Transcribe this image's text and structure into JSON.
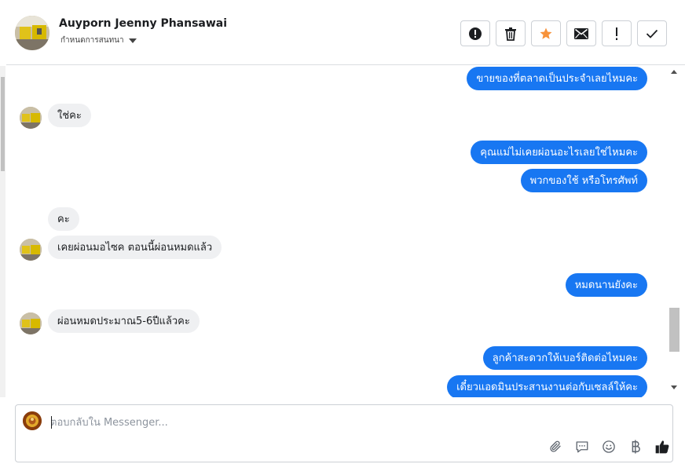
{
  "header": {
    "contact_name": "Auyporn Jeenny Phansawai",
    "status_label": "กำหนดการสนทนา",
    "actions": [
      {
        "name": "report-button",
        "icon": "alert-circle-icon"
      },
      {
        "name": "delete-button",
        "icon": "trash-icon"
      },
      {
        "name": "star-button",
        "icon": "star-icon",
        "color": "#f7923a"
      },
      {
        "name": "mark-unread-button",
        "icon": "envelope-icon"
      },
      {
        "name": "spam-button",
        "icon": "exclamation-icon"
      },
      {
        "name": "done-button",
        "icon": "check-icon"
      }
    ]
  },
  "messages": [
    {
      "direction": "out",
      "text": "ขายของที่ตลาดเป็นประจำเลยไหมคะ"
    },
    {
      "direction": "in",
      "text": "ใช่คะ"
    },
    {
      "direction": "out",
      "text": "คุณแม่ไม่เคยผ่อนอะไรเลยใช่ไหมคะ"
    },
    {
      "direction": "out",
      "text": "พวกของใช้ หรือโทรศัพท์"
    },
    {
      "direction": "in",
      "text": "คะ"
    },
    {
      "direction": "in",
      "text": "เคยผ่อนมอไซค ตอนนี้ผ่อนหมดแล้ว"
    },
    {
      "direction": "out",
      "text": "หมดนานยังคะ"
    },
    {
      "direction": "in",
      "text": "ผ่อนหมดประมาณ5-6ปีแล้วคะ"
    },
    {
      "direction": "out",
      "text": "ลูกค้าสะดวกให้เบอร์ติดต่อไหมคะ"
    },
    {
      "direction": "out",
      "text": "เดี๋ยวแอดมินประสานงานต่อกับเซลล์ให้คะ"
    }
  ],
  "composer": {
    "placeholder": "ตอบกลับใน Messenger...",
    "value": "",
    "tools": [
      "paperclip-icon",
      "saved-reply-icon",
      "emoji-icon",
      "baht-icon",
      "thumbs-up-icon"
    ]
  },
  "colors": {
    "outgoing_bubble": "#1877f2",
    "incoming_bubble": "#eff0f2",
    "star_accent": "#f7923a"
  }
}
